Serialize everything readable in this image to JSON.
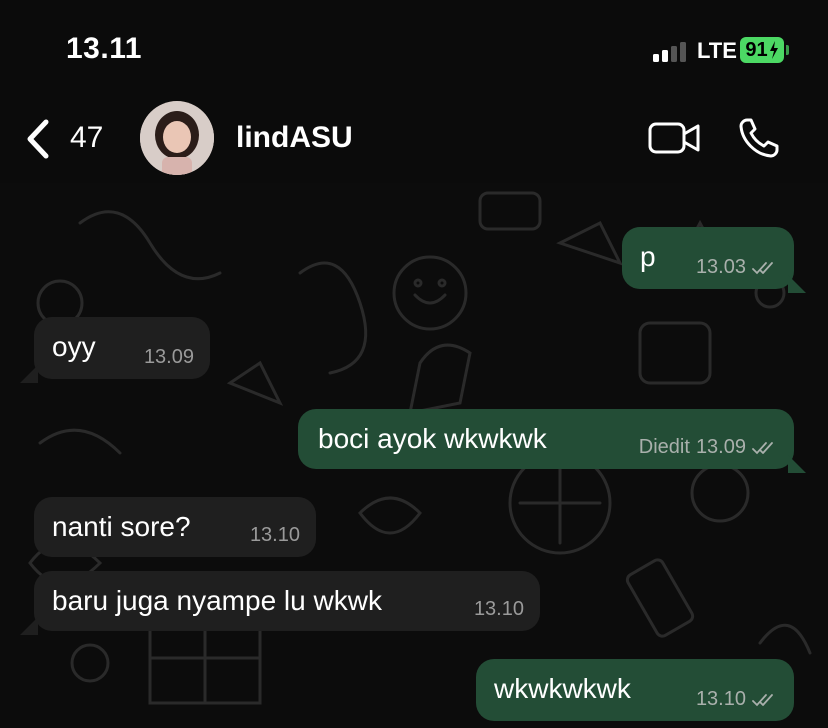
{
  "status": {
    "time": "13.11",
    "network": "LTE",
    "battery": "91"
  },
  "header": {
    "back_count": "47",
    "contact_name": "lindASU"
  },
  "messages": [
    {
      "dir": "out",
      "text": "p",
      "time": "13.03",
      "edited": ""
    },
    {
      "dir": "in",
      "text": "oyy",
      "time": "13.09"
    },
    {
      "dir": "out",
      "text": "boci ayok wkwkwk",
      "time": "13.09",
      "edited": "Diedit"
    },
    {
      "dir": "in",
      "text": "nanti sore?",
      "time": "13.10"
    },
    {
      "dir": "in",
      "text": "baru juga nyampe lu wkwk",
      "time": "13.10"
    },
    {
      "dir": "out",
      "text": "wkwkwkwk",
      "time": "13.10",
      "edited": ""
    }
  ],
  "icons": {
    "back": "chevron-left-icon",
    "video": "video-camera-icon",
    "call": "phone-icon",
    "read": "double-check-icon"
  },
  "colors": {
    "incoming_bubble": "#1f1f1f",
    "outgoing_bubble": "#234d36",
    "battery": "#4cd964",
    "background": "#0c0c0c"
  }
}
